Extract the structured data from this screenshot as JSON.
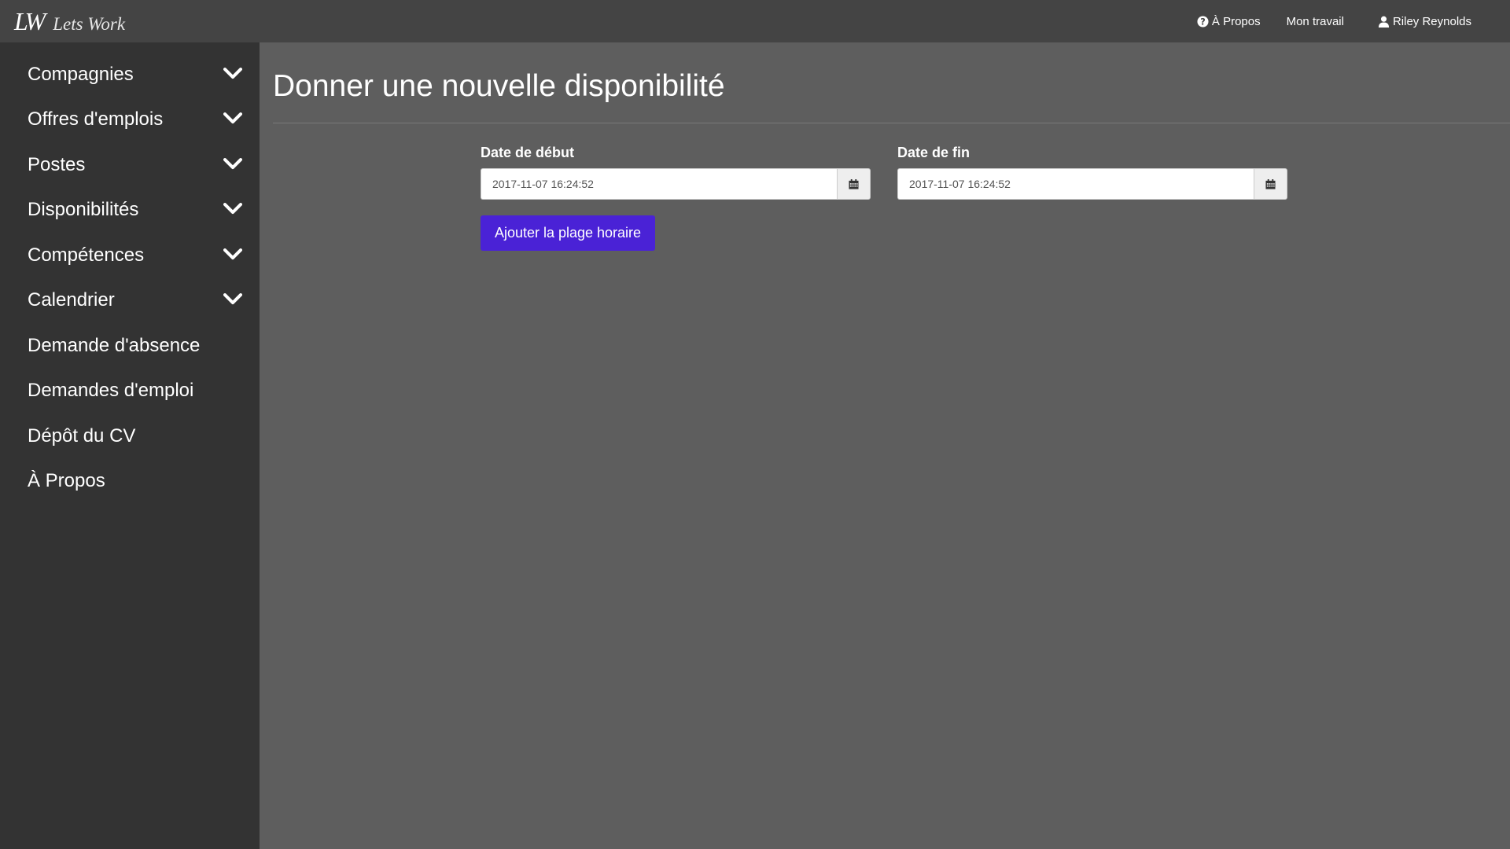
{
  "header": {
    "brand_logo": "LW",
    "brand_name": "Lets Work",
    "nav": {
      "about": "À Propos",
      "my_work": "Mon travail",
      "user": "Riley Reynolds"
    }
  },
  "sidebar": {
    "items": [
      {
        "label": "Compagnies",
        "expandable": true
      },
      {
        "label": "Offres d'emplois",
        "expandable": true
      },
      {
        "label": "Postes",
        "expandable": true
      },
      {
        "label": "Disponibilités",
        "expandable": true
      },
      {
        "label": "Compétences",
        "expandable": true
      },
      {
        "label": "Calendrier",
        "expandable": true
      },
      {
        "label": "Demande d'absence",
        "expandable": false
      },
      {
        "label": "Demandes d'emploi",
        "expandable": false
      },
      {
        "label": "Dépôt du CV",
        "expandable": false
      },
      {
        "label": "À Propos",
        "expandable": false
      }
    ]
  },
  "main": {
    "title": "Donner une nouvelle disponibilité",
    "start_date": {
      "label": "Date de début",
      "value": "2017-11-07 16:24:52",
      "icon": "calendar-icon"
    },
    "end_date": {
      "label": "Date de fin",
      "value": "2017-11-07 16:24:52",
      "icon": "calendar-icon"
    },
    "submit_label": "Ajouter la plage horaire"
  },
  "colors": {
    "navbar": "#444444",
    "sidebar": "#333333",
    "main_bg": "#5e5e5e",
    "primary_button": "#4a22d6"
  }
}
